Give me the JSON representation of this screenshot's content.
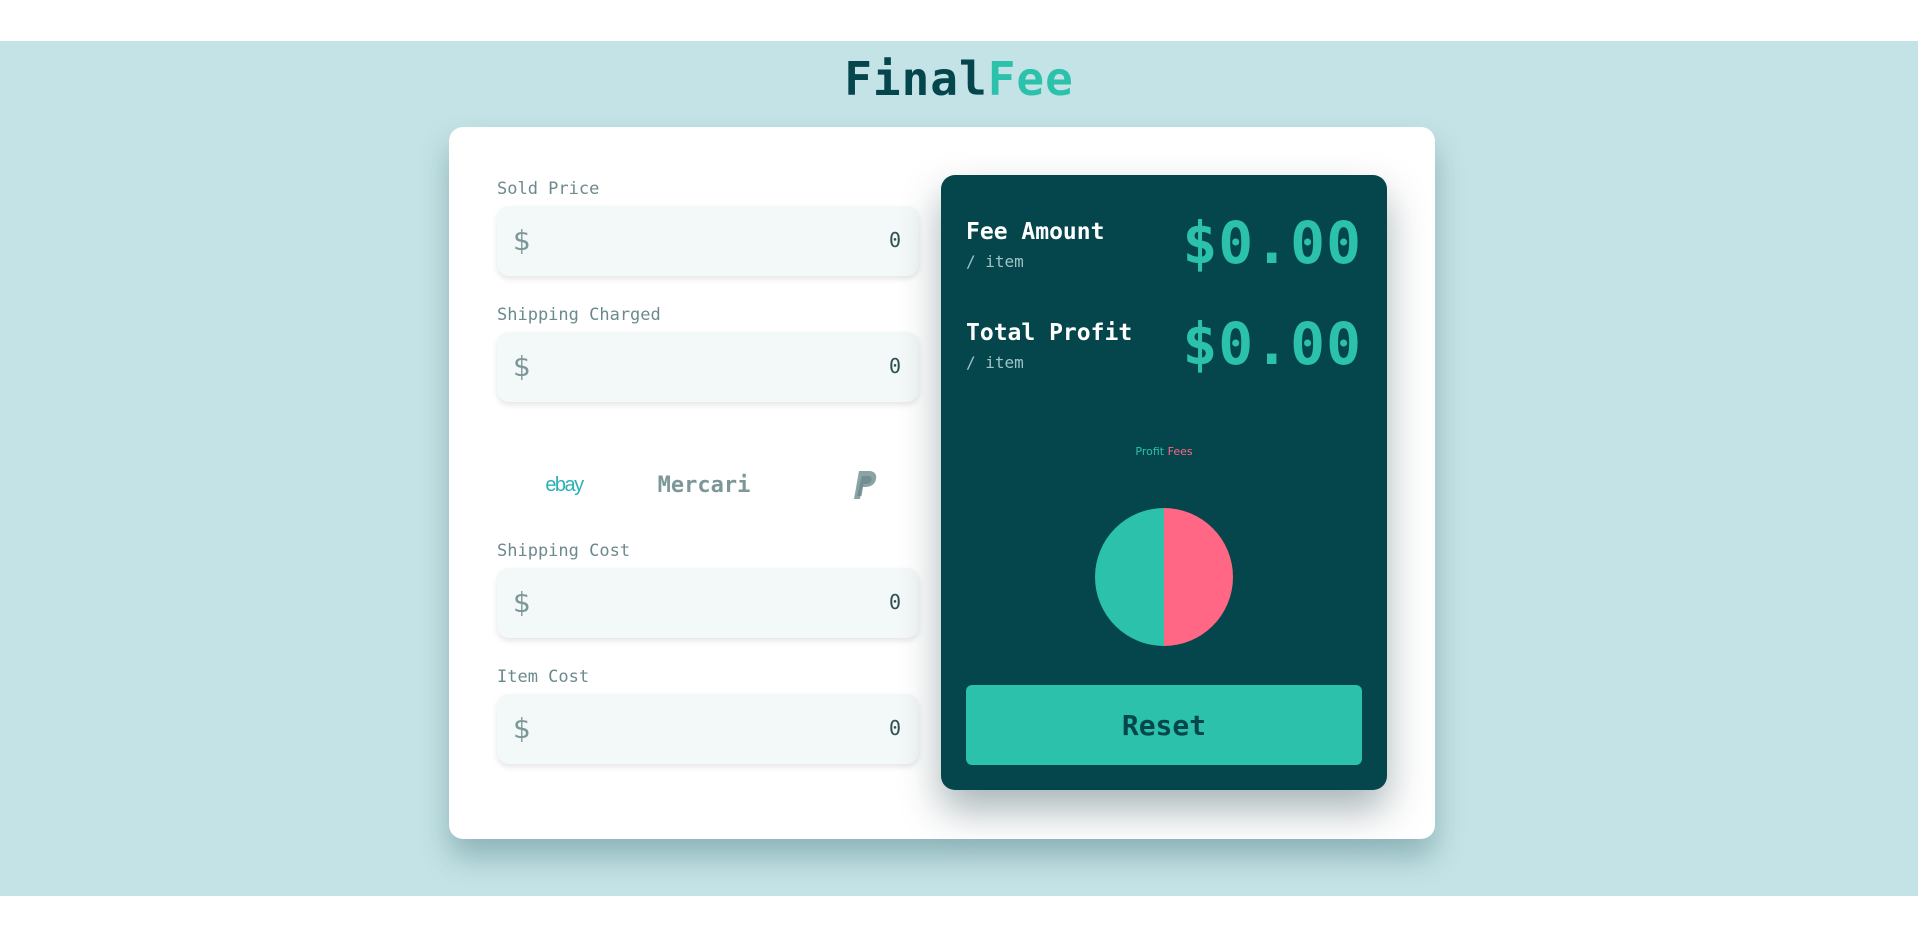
{
  "app": {
    "logo_part1": "Final",
    "logo_part2": "Fee"
  },
  "colors": {
    "background_band": "#c4e3e6",
    "dark_teal": "#05464d",
    "accent_teal": "#2bc1ab",
    "fees_pink": "#ff6784"
  },
  "inputs": {
    "sold_price": {
      "label": "Sold Price",
      "currency": "$",
      "value": "0"
    },
    "shipping_charged": {
      "label": "Shipping Charged",
      "currency": "$",
      "value": "0"
    },
    "shipping_cost": {
      "label": "Shipping Cost",
      "currency": "$",
      "value": "0"
    },
    "item_cost": {
      "label": "Item Cost",
      "currency": "$",
      "value": "0"
    }
  },
  "platforms": {
    "ebay": "ebay",
    "mercari": "Mercari",
    "paypal_icon": "paypal-icon"
  },
  "results": {
    "fee_amount_label": "Fee Amount",
    "fee_amount_sub": "/ item",
    "fee_amount_value": "$0.00",
    "total_profit_label": "Total Profit",
    "total_profit_sub": "/ item",
    "total_profit_value": "$0.00",
    "legend_profit": "Profit",
    "legend_fees": "Fees",
    "reset_label": "Reset"
  },
  "chart_data": {
    "type": "pie",
    "labels": [
      "Profit",
      "Fees"
    ],
    "values": [
      50,
      50
    ],
    "colors": [
      "#2bc1ab",
      "#ff6784"
    ]
  }
}
